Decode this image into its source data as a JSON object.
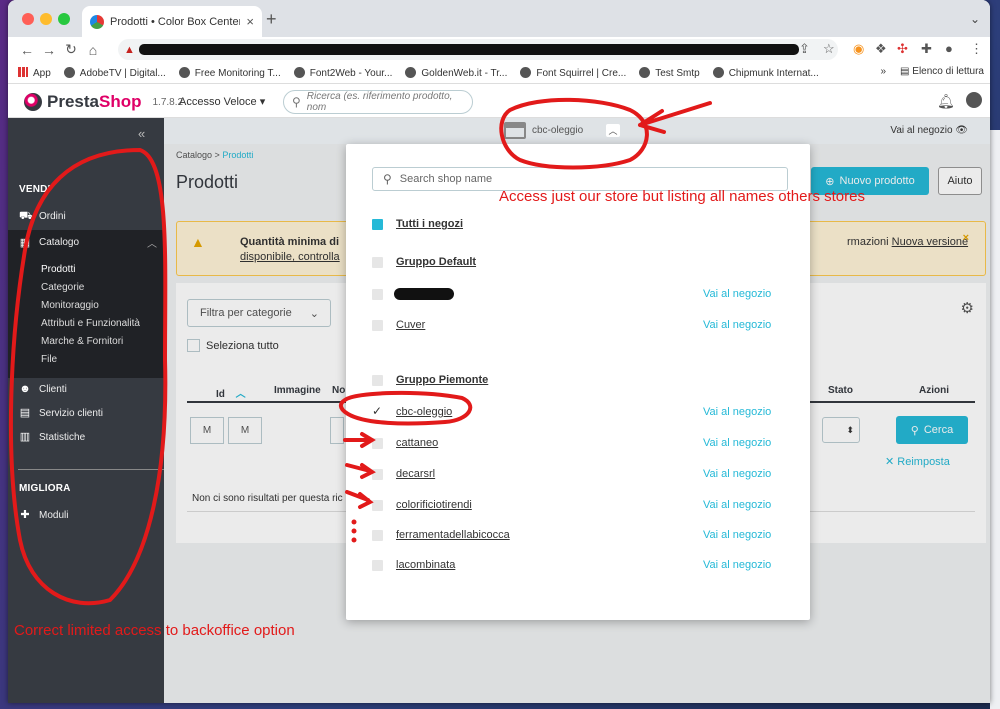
{
  "browser": {
    "tab_title": "Prodotti • Color Box Center Ol…",
    "close": "×",
    "new_tab": "+",
    "tab_menu": "⌄",
    "bookmarks": [
      "App",
      "AdobeTV | Digital...",
      "Free Monitoring T...",
      "Font2Web - Your...",
      "GoldenWeb.it - Tr...",
      "Font Squirrel | Cre...",
      "Test Smtp",
      "Chipmunk Internat..."
    ],
    "bookmarks_more": "»",
    "reading_list": "Elenco di lettura"
  },
  "header": {
    "logo_pre": "Presta",
    "logo_post": "Shop",
    "version": "1.7.8.2",
    "quick_access": "Accesso Veloce",
    "search_placeholder": "Ricerca (es. riferimento prodotto, nom"
  },
  "sidebar": {
    "collapse": "«",
    "section_sell": "VENDI",
    "orders": "Ordini",
    "catalog": "Catalogo",
    "catalog_sub": [
      "Prodotti",
      "Categorie",
      "Monitoraggio",
      "Attributi e Funzionalità",
      "Marche & Fornitori",
      "File"
    ],
    "customers": "Clienti",
    "customer_service": "Servizio clienti",
    "stats": "Statistiche",
    "section_improve": "MIGLIORA",
    "modules": "Moduli"
  },
  "shopbar": {
    "current_shop": "cbc-oleggio",
    "view_shop": "Vai al negozio"
  },
  "page": {
    "breadcrumb_parent": "Catalogo",
    "breadcrumb_sep": ">",
    "breadcrumb_current": "Prodotti",
    "title": "Prodotti",
    "new_product": "Nuovo prodotto",
    "help": "Aiuto",
    "alert_line1": "Quantità minima di",
    "alert_line2": "disponibile, controlla",
    "alert_line1_right": "rmazioni",
    "alert_new_version": "Nuova versione",
    "alert_close": "×",
    "filter_categories": "Filtra per categorie",
    "select_all": "Seleziona tutto",
    "col_id": "Id",
    "col_image": "Immagine",
    "col_name": "No",
    "col_status": "Stato",
    "col_actions": "Azioni",
    "filter_m1": "M",
    "filter_m2": "M",
    "search_btn": "Cerca",
    "reset": "Reimposta",
    "no_results": "Non ci sono risultati per questa ric"
  },
  "shop_dropdown": {
    "search_placeholder": "Search shop name",
    "all_shops": "Tutti i negozi",
    "view_shop": "Vai al negozio",
    "groups": [
      {
        "name": "Gruppo Default",
        "shops": [
          "",
          "Cuver"
        ]
      },
      {
        "name": "Gruppo Piemonte",
        "shops": [
          "cbc-oleggio",
          "cattaneo",
          "decarsrl",
          "colorificiotirendi",
          "ferramentadellabicocca",
          "lacombinata"
        ]
      }
    ],
    "selected_shop": "cbc-oleggio"
  },
  "annotations": {
    "top": "Access just our store but listing all names others stores",
    "bottom": "Correct limited access to backoffice option"
  },
  "colors": {
    "accent": "#25b9d7",
    "brand": "#df0067",
    "sidebar": "#363a41",
    "annotation": "#e21a1a"
  }
}
